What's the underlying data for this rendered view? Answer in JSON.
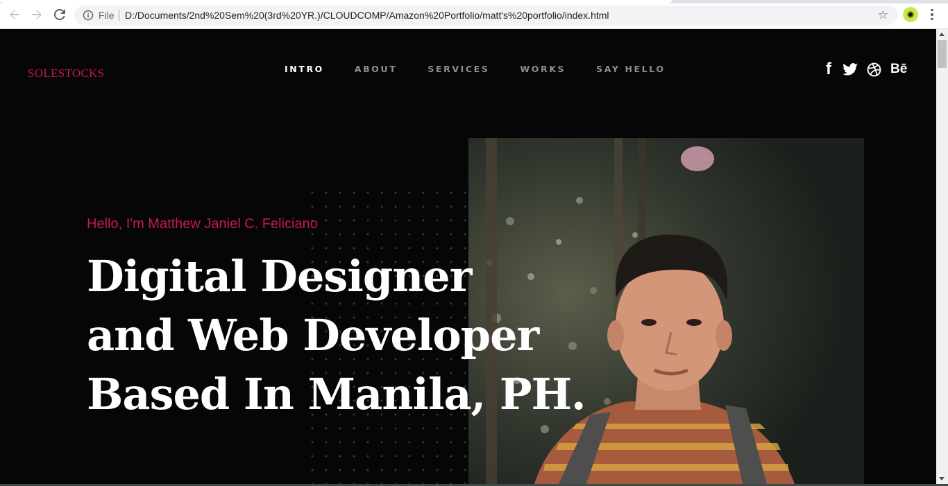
{
  "browser": {
    "scheme_label": "File",
    "url": "D:/Documents/2nd%20Sem%20(3rd%20YR.)/CLOUDCOMP/Amazon%20Portfolio/matt's%20portfolio/index.html"
  },
  "site": {
    "logo": "SOLESTOCKS",
    "nav": [
      {
        "label": "INTRO",
        "active": true
      },
      {
        "label": "ABOUT",
        "active": false
      },
      {
        "label": "SERVICES",
        "active": false
      },
      {
        "label": "WORKS",
        "active": false
      },
      {
        "label": "SAY HELLO",
        "active": false
      }
    ],
    "social": {
      "facebook": "f",
      "behance": "Bē"
    }
  },
  "hero": {
    "greeting": "Hello, I'm Matthew Janiel C. Feliciano",
    "headline_lines": [
      "Digital Designer",
      "and Web Developer",
      "Based In Manila, PH."
    ]
  },
  "colors": {
    "accent": "#c2185b",
    "background": "#060606",
    "text": "#ffffff",
    "nav_inactive": "#8f8f8f"
  }
}
